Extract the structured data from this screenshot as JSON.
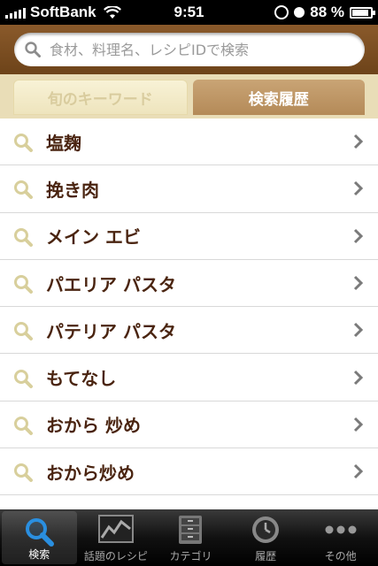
{
  "status_bar": {
    "carrier": "SoftBank",
    "time": "9:51",
    "battery": "88 %",
    "battery_level": 0.88,
    "icons": [
      "signal-bars-icon",
      "wifi-icon",
      "rotation-lock-icon",
      "alarm-icon",
      "battery-icon"
    ]
  },
  "search": {
    "placeholder": "食材、料理名、レシピIDで検索",
    "icon": "search-icon"
  },
  "tabs": [
    {
      "label": "旬のキーワード",
      "active": false
    },
    {
      "label": "検索履歴",
      "active": true
    }
  ],
  "history": {
    "items": [
      {
        "label": "塩麹"
      },
      {
        "label": "挽き肉"
      },
      {
        "label": "メイン エビ"
      },
      {
        "label": "パエリア パスタ"
      },
      {
        "label": "パテリア パスタ"
      },
      {
        "label": "もてなし"
      },
      {
        "label": "おから 炒め"
      },
      {
        "label": "おから炒め"
      }
    ]
  },
  "tabbar": {
    "items": [
      {
        "label": "検索",
        "icon": "search-icon",
        "selected": true
      },
      {
        "label": "話題のレシピ",
        "icon": "trend-chart-icon",
        "selected": false
      },
      {
        "label": "カテゴリ",
        "icon": "cabinet-icon",
        "selected": false
      },
      {
        "label": "履歴",
        "icon": "clock-icon",
        "selected": false
      },
      {
        "label": "その他",
        "icon": "more-icon",
        "selected": false
      }
    ]
  },
  "colors": {
    "header_brown": "#7a4d22",
    "tab_active": "#b48a58",
    "tab_bar_bg": "#e9ddb7",
    "item_text": "#4a2410"
  }
}
